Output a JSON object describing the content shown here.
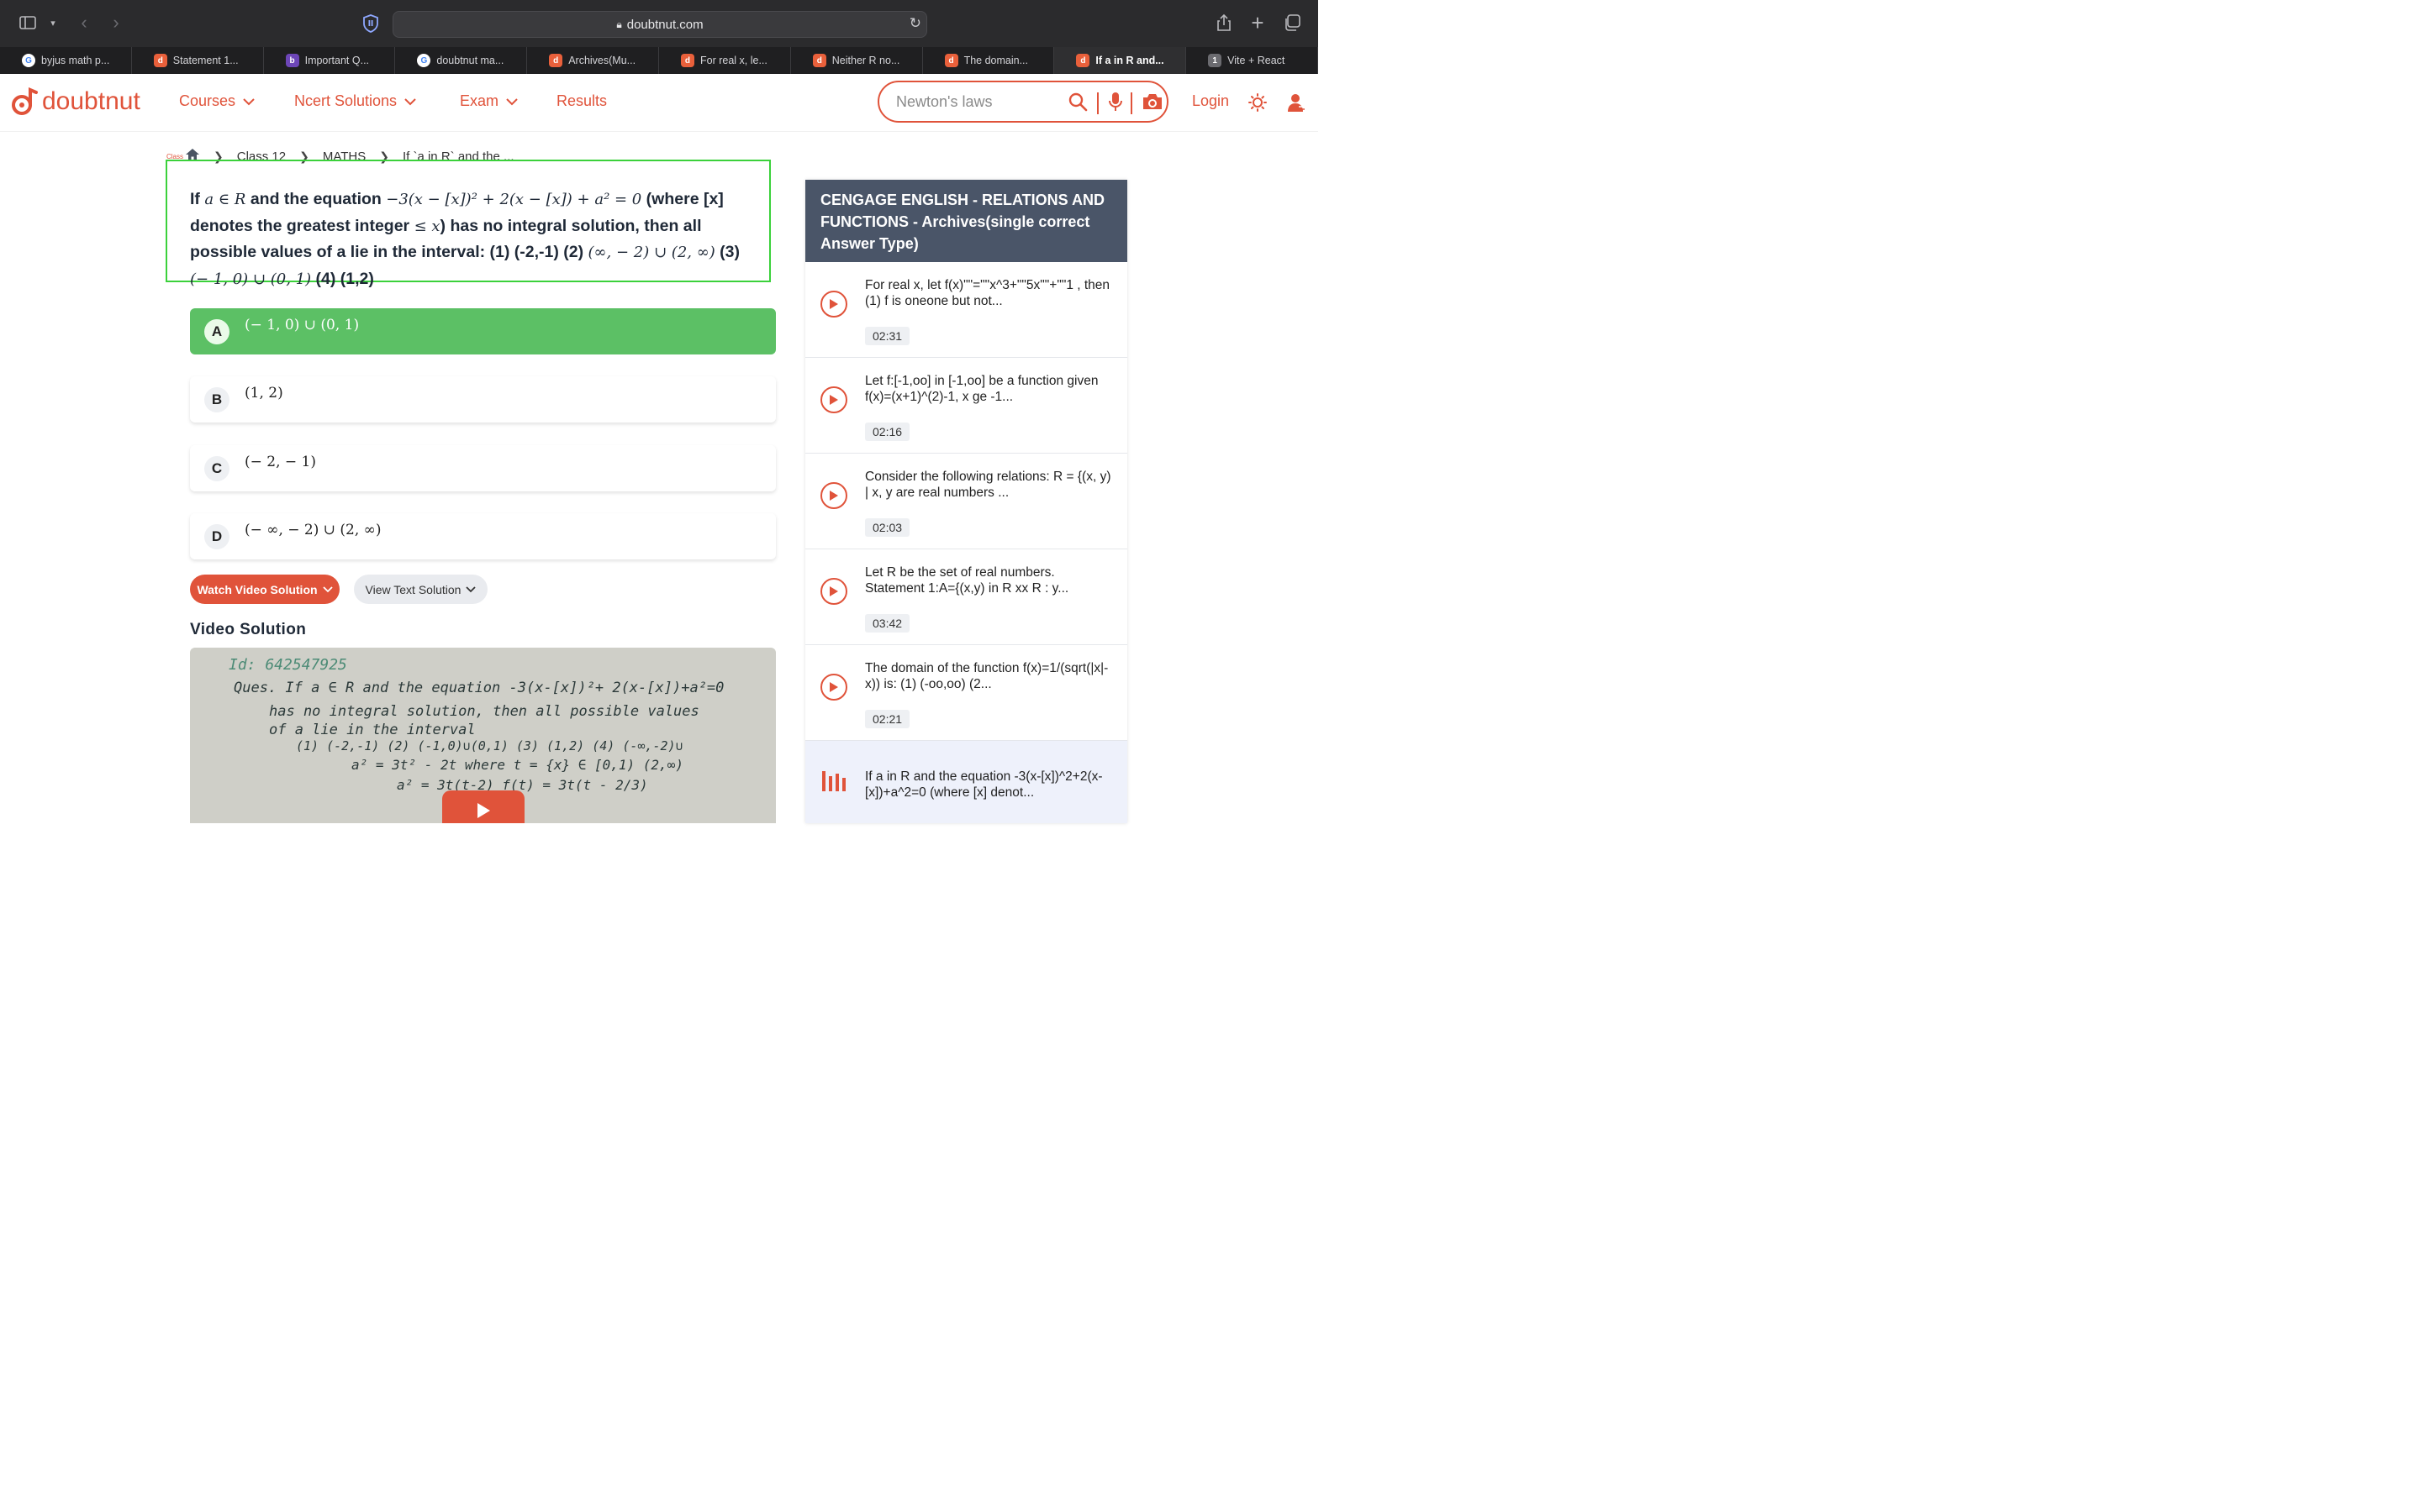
{
  "browser": {
    "url": "doubtnut.com",
    "tabs": [
      {
        "label": "byjus math p...",
        "icon": "google-favicon"
      },
      {
        "label": "Statement 1...",
        "icon": "doubtnut-favicon"
      },
      {
        "label": "Important Q...",
        "icon": "bookmark-favicon"
      },
      {
        "label": "doubtnut ma...",
        "icon": "google-favicon"
      },
      {
        "label": "Archives(Mu...",
        "icon": "doubtnut-favicon"
      },
      {
        "label": "For real x, le...",
        "icon": "doubtnut-favicon"
      },
      {
        "label": "Neither R no...",
        "icon": "doubtnut-favicon"
      },
      {
        "label": "The domain...",
        "icon": "doubtnut-favicon"
      },
      {
        "label": "If a in R and...",
        "icon": "doubtnut-favicon",
        "active": true
      },
      {
        "label": "Vite + React",
        "icon": "numbered-favicon",
        "badge": "1"
      }
    ]
  },
  "header": {
    "logo_text": "doubtnut",
    "nav": {
      "courses": "Courses",
      "ncert": "Ncert Solutions",
      "exam": "Exam",
      "results": "Results"
    },
    "search_placeholder": "Newton's laws",
    "login": "Login",
    "brand_color": "#e0533a"
  },
  "breadcrumb": {
    "home_label": "Class",
    "class": "Class 12",
    "subject": "MATHS",
    "current": "If `a in R` and the ..."
  },
  "question": {
    "p1": "If ",
    "m1": "a ∈ R",
    "p2": " and the equation ",
    "m2": "−3(x − [x])² + 2(x − [x]) + a² = 0",
    "p3": " (where [x] denotes the greatest integer ",
    "m3": "≤ x",
    "p4": ") has no integral solution, then all possible values of a lie in the interval: (1) (-2,-1) (2) ",
    "m4": "(∞, − 2) ∪ (2, ∞)",
    "p5": " (3) ",
    "m5": "(− 1, 0) ∪ (0, 1)",
    "p6": " (4) (1,2)"
  },
  "options": [
    {
      "letter": "A",
      "text": "(− 1, 0) ∪ (0, 1)",
      "correct": true
    },
    {
      "letter": "B",
      "text": "(1, 2)"
    },
    {
      "letter": "C",
      "text": "(− 2, − 1)"
    },
    {
      "letter": "D",
      "text": "(− ∞, − 2) ∪ (2, ∞)"
    }
  ],
  "buttons": {
    "watch": "Watch Video Solution",
    "text": "View Text Solution"
  },
  "video": {
    "title": "Video Solution",
    "notes": [
      "Id: 642547925",
      "Ques. If  a ∈ R and the equation -3(x-[x])²+ 2(x-[x])+a²=0",
      "has  no  integral solution, then all possible values",
      "of a lie in  the  interval",
      "(1) (-2,-1)   (2)  (-1,0)∪(0,1)   (3) (1,2)   (4) (-∞,-2)∪",
      "a² = 3t² - 2t    where  t = {x} ∈ [0,1)     (2,∞)",
      "a² = 3t(t-2)            f(t) = 3t(t - 2/3)"
    ]
  },
  "panel": {
    "heading": "CENGAGE ENGLISH  -  RELATIONS AND FUNCTIONS  -  Archives(single correct Answer Type)",
    "items": [
      {
        "title": "For real x, let f(x)\"\"=\"\"x^3+\"\"5x\"\"+\"\"1 , then (1) f is oneone but not...",
        "duration": "02:31"
      },
      {
        "title": "Let f:[-1,oo] in [-1,oo] be a function given f(x)=(x+1)^(2)-1, x ge -1...",
        "duration": "02:16"
      },
      {
        "title": "Consider the following relations: R = {(x, y) | x, y are real numbers ...",
        "duration": "02:03"
      },
      {
        "title": "Let R be the set of real numbers. Statement 1:A={(x,y) in R xx R : y...",
        "duration": "03:42"
      },
      {
        "title": "The domain of the function f(x)=1/(sqrt(|x|-x)) is: (1) (-oo,oo) (2...",
        "duration": "02:21"
      },
      {
        "title": "If a in R and the equation -3(x-[x])^2+2(x-[x])+a^2=0 (where [x] denot...",
        "playing": true
      }
    ]
  }
}
